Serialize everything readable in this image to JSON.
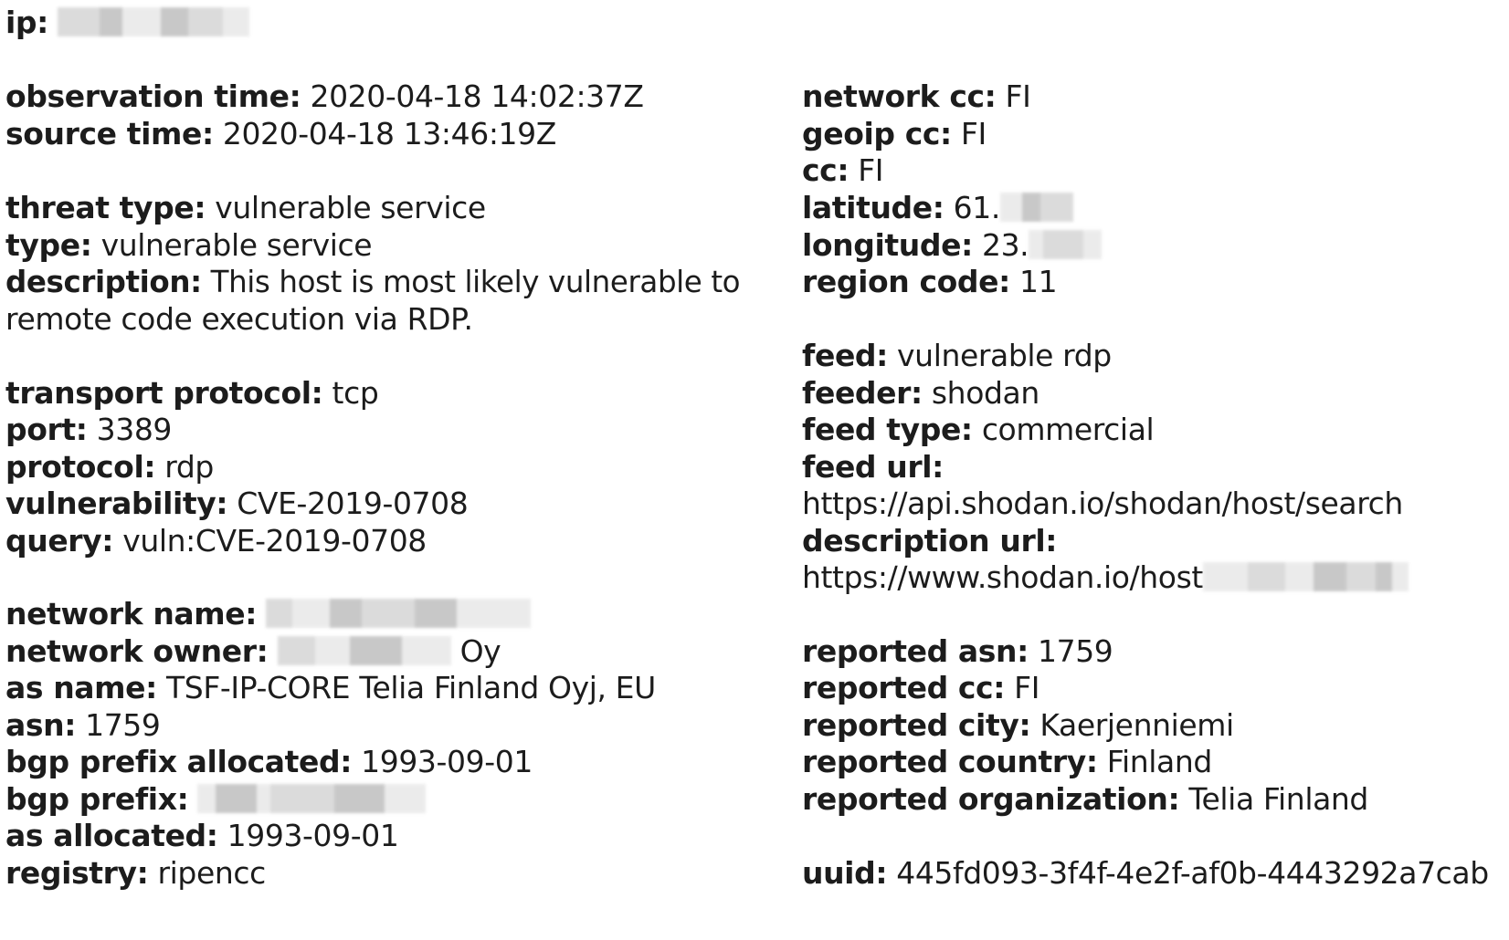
{
  "left": {
    "ip": {
      "label": "ip:"
    },
    "observation_time": {
      "label": "observation time:",
      "value": "2020-04-18 14:02:37Z"
    },
    "source_time": {
      "label": "source time:",
      "value": "2020-04-18 13:46:19Z"
    },
    "threat_type": {
      "label": "threat type:",
      "value": "vulnerable service"
    },
    "type": {
      "label": "type:",
      "value": "vulnerable service"
    },
    "description": {
      "label": "description:",
      "value_line1": "This host is most likely vulnerable to",
      "value_line2": "remote code execution via RDP."
    },
    "transport_protocol": {
      "label": "transport protocol:",
      "value": "tcp"
    },
    "port": {
      "label": "port:",
      "value": "3389"
    },
    "protocol": {
      "label": "protocol:",
      "value": "rdp"
    },
    "vulnerability": {
      "label": "vulnerability:",
      "value": "CVE-2019-0708"
    },
    "query": {
      "label": "query:",
      "value": "vuln:CVE-2019-0708"
    },
    "network_name": {
      "label": "network name:"
    },
    "network_owner": {
      "label": "network owner:",
      "value_suffix": "Oy"
    },
    "as_name": {
      "label": "as name:",
      "value": "TSF-IP-CORE Telia Finland Oyj, EU"
    },
    "asn": {
      "label": "asn:",
      "value": "1759"
    },
    "bgp_prefix_allocated": {
      "label": "bgp prefix allocated:",
      "value": "1993-09-01"
    },
    "bgp_prefix": {
      "label": "bgp prefix:"
    },
    "as_allocated": {
      "label": "as allocated:",
      "value": "1993-09-01"
    },
    "registry": {
      "label": "registry:",
      "value": "ripencc"
    }
  },
  "right": {
    "network_cc": {
      "label": "network cc:",
      "value": "FI"
    },
    "geoip_cc": {
      "label": "geoip cc:",
      "value": "FI"
    },
    "cc": {
      "label": "cc:",
      "value": "FI"
    },
    "latitude": {
      "label": "latitude:",
      "value_prefix": "61."
    },
    "longitude": {
      "label": "longitude:",
      "value_prefix": "23."
    },
    "region_code": {
      "label": "region code:",
      "value": "11"
    },
    "feed": {
      "label": "feed:",
      "value": "vulnerable rdp"
    },
    "feeder": {
      "label": "feeder:",
      "value": "shodan"
    },
    "feed_type": {
      "label": "feed type:",
      "value": "commercial"
    },
    "feed_url": {
      "label": "feed url:",
      "value": "https://api.shodan.io/shodan/host/search"
    },
    "description_url": {
      "label": "description url:",
      "value_prefix": "https://www.shodan.io/host"
    },
    "reported_asn": {
      "label": "reported asn:",
      "value": "1759"
    },
    "reported_cc": {
      "label": "reported cc:",
      "value": "FI"
    },
    "reported_city": {
      "label": "reported city:",
      "value": "Kaerjenniemi"
    },
    "reported_country": {
      "label": "reported country:",
      "value": "Finland"
    },
    "reported_organization": {
      "label": "reported organization:",
      "value": "Telia Finland"
    },
    "uuid": {
      "label": "uuid:",
      "value": "445fd093-3f4f-4e2f-af0b-4443292a7cab"
    }
  }
}
